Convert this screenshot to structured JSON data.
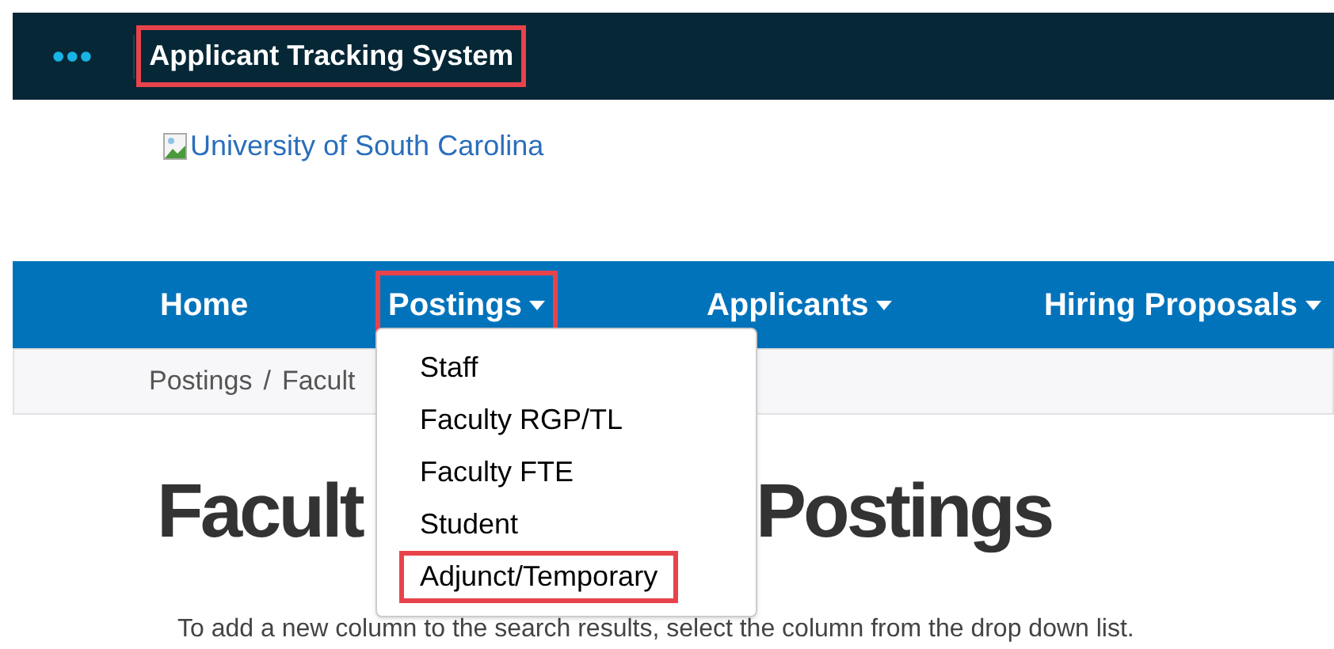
{
  "top_bar": {
    "menu_icon": "•••",
    "title": "Applicant Tracking System",
    "highlighted": true
  },
  "logo_link": {
    "text": "University of South Carolina"
  },
  "nav": [
    {
      "label": "Home",
      "has_caret": false,
      "highlighted": false
    },
    {
      "label": "Postings",
      "has_caret": true,
      "highlighted": true
    },
    {
      "label": "Applicants",
      "has_caret": true,
      "highlighted": false
    },
    {
      "label": "Hiring Proposals",
      "has_caret": true,
      "highlighted": false
    }
  ],
  "dropdown": [
    {
      "label": "Staff",
      "highlighted": false
    },
    {
      "label": "Faculty RGP/TL",
      "highlighted": false
    },
    {
      "label": "Faculty FTE",
      "highlighted": false
    },
    {
      "label": "Student",
      "highlighted": false
    },
    {
      "label": "Adjunct/Temporary",
      "highlighted": true
    }
  ],
  "breadcrumb": [
    "Postings",
    "Facult"
  ],
  "breadcrumb_separator": "/",
  "heading": [
    "Facult",
    "Postings"
  ],
  "instructions": "To add a new column to the search results, select the column from the drop down list."
}
